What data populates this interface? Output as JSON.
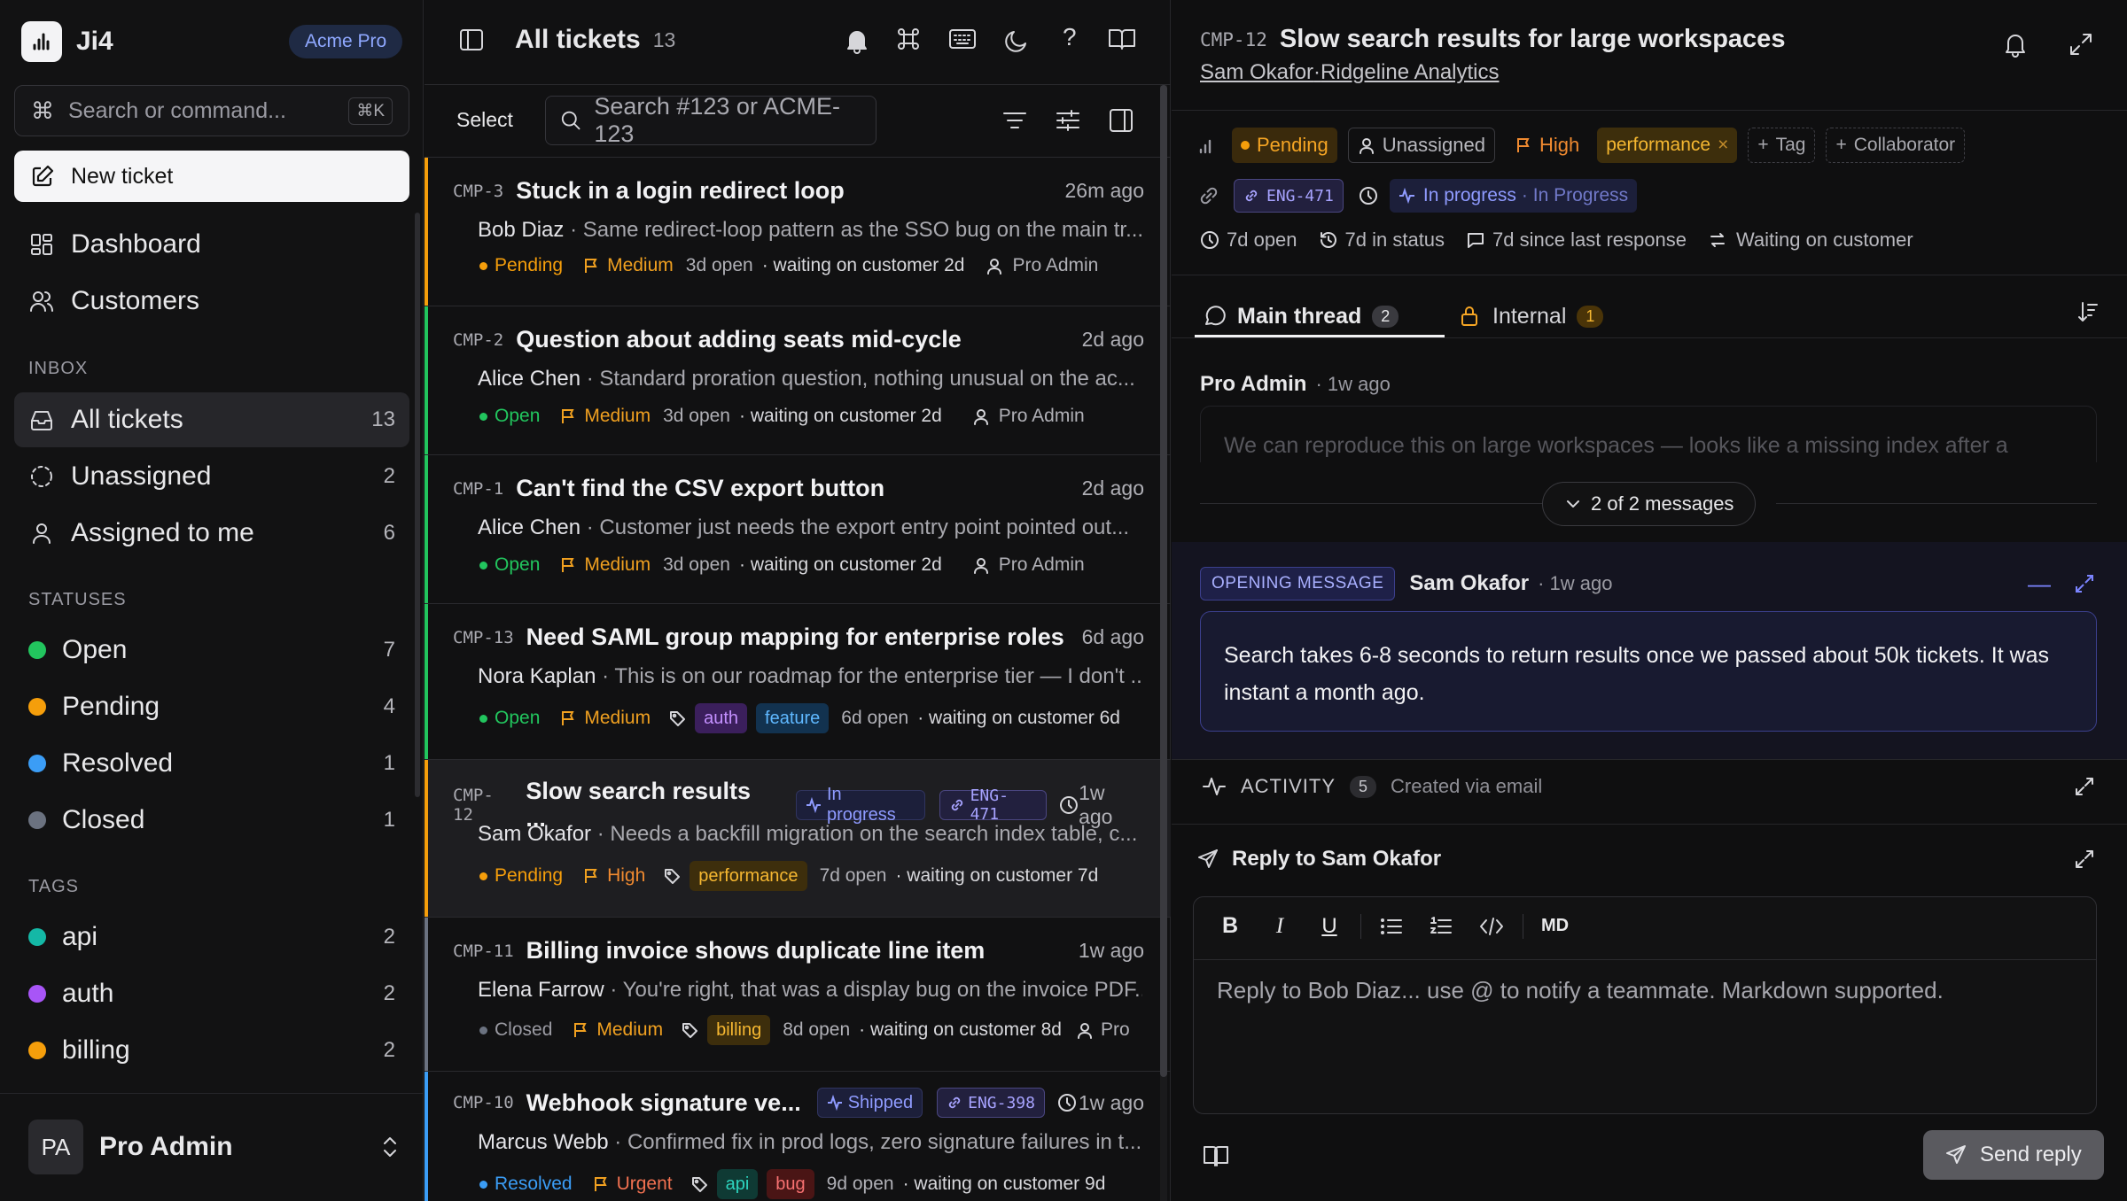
{
  "brand": {
    "name": "Ji4",
    "plan": "Acme Pro"
  },
  "sidebar": {
    "search_placeholder": "Search or command...",
    "search_shortcut": "⌘K",
    "new_ticket": "New ticket",
    "nav": [
      {
        "label": "Dashboard"
      },
      {
        "label": "Customers"
      }
    ],
    "inbox_title": "INBOX",
    "inbox": [
      {
        "label": "All tickets",
        "count": "13"
      },
      {
        "label": "Unassigned",
        "count": "2"
      },
      {
        "label": "Assigned to me",
        "count": "6"
      }
    ],
    "statuses_title": "STATUSES",
    "statuses": [
      {
        "label": "Open",
        "count": "7",
        "color": "#22c55e"
      },
      {
        "label": "Pending",
        "count": "4",
        "color": "#f59e0b"
      },
      {
        "label": "Resolved",
        "count": "1",
        "color": "#3b82f6"
      },
      {
        "label": "Closed",
        "count": "1",
        "color": "#6b7280"
      }
    ],
    "tags_title": "TAGS",
    "tags": [
      {
        "label": "api",
        "count": "2",
        "color": "#14b8a6"
      },
      {
        "label": "auth",
        "count": "2",
        "color": "#a855f7"
      },
      {
        "label": "billing",
        "count": "2",
        "color": "#f59e0b"
      }
    ],
    "user": {
      "initials": "PA",
      "name": "Pro Admin"
    }
  },
  "list": {
    "title": "All tickets",
    "count": "13",
    "select_label": "Select",
    "search_placeholder": "Search #123 or ACME-123",
    "tickets": [
      {
        "id": "CMP-3",
        "title": "Stuck in a login redirect loop",
        "age": "26m ago",
        "customer": "Bob Diaz",
        "preview": "· Same redirect-loop pattern as the SSO bug on the main tr...",
        "status": "Pending",
        "priority": "Medium",
        "open": "3d open",
        "waiting": "· waiting on customer 2d",
        "assignee": "Pro Admin"
      },
      {
        "id": "CMP-2",
        "title": "Question about adding seats mid-cycle",
        "age": "2d ago",
        "customer": "Alice Chen",
        "preview": "· Standard proration question, nothing unusual on the ac...",
        "status": "Open",
        "priority": "Medium",
        "open": "3d open",
        "waiting": "· waiting on customer 2d",
        "assignee": "Pro Admin"
      },
      {
        "id": "CMP-1",
        "title": "Can't find the CSV export button",
        "age": "2d ago",
        "customer": "Alice Chen",
        "preview": "· Customer just needs the export entry point pointed out...",
        "status": "Open",
        "priority": "Medium",
        "open": "3d open",
        "waiting": "· waiting on customer 2d",
        "assignee": "Pro Admin"
      },
      {
        "id": "CMP-13",
        "title": "Need SAML group mapping for enterprise roles",
        "age": "6d ago",
        "customer": "Nora Kaplan",
        "preview": "· This is on our roadmap for the enterprise tier — I don't ...",
        "status": "Open",
        "priority": "Medium",
        "tags": [
          "auth",
          "feature"
        ],
        "open": "6d open",
        "waiting": "· waiting on customer 6d"
      },
      {
        "id": "CMP-12",
        "title": "Slow search results ...",
        "age": "1w ago",
        "customer": "Sam Okafor",
        "preview": "· Needs a backfill migration on the search index table, c...",
        "status": "Pending",
        "priority": "High",
        "tags": [
          "performance"
        ],
        "open": "7d open",
        "waiting": "· waiting on customer 7d",
        "badge": "In progress",
        "link": "ENG-471"
      },
      {
        "id": "CMP-11",
        "title": "Billing invoice shows duplicate line item",
        "age": "1w ago",
        "customer": "Elena Farrow",
        "preview": "· You're right, that was a display bug on the invoice PDF...",
        "status": "Closed",
        "priority": "Medium",
        "tags": [
          "billing"
        ],
        "open": "8d open",
        "waiting": "· waiting on customer 8d",
        "assignee": "Pro"
      },
      {
        "id": "CMP-10",
        "title": "Webhook signature ve...",
        "age": "1w ago",
        "customer": "Marcus Webb",
        "preview": "· Confirmed fix in prod logs, zero signature failures in t...",
        "status": "Resolved",
        "priority": "Urgent",
        "tags": [
          "api",
          "bug"
        ],
        "open": "9d open",
        "waiting": "· waiting on customer 9d",
        "badge": "Shipped",
        "link": "ENG-398"
      }
    ]
  },
  "detail": {
    "id": "CMP-12",
    "title": "Slow search results for large workspaces",
    "customer": "Sam Okafor",
    "company": "Ridgeline Analytics",
    "status": "Pending",
    "assignee": "Unassigned",
    "priority": "High",
    "tag": "performance",
    "add_tag": "Tag",
    "collaborator": "Collaborator",
    "link": "ENG-471",
    "progress": "In progress",
    "progress_sub": "· In Progress",
    "stats": [
      "7d open",
      "7d in status",
      "7d since last response",
      "Waiting on customer"
    ],
    "tabs": [
      {
        "label": "Main thread",
        "count": "2"
      },
      {
        "label": "Internal",
        "count": "1"
      }
    ],
    "thread": {
      "author": "Pro Admin",
      "time": "· 1w ago",
      "preview": "We can reproduce this on large workspaces — looks like a missing index after a",
      "collapse": "2 of 2 messages"
    },
    "opening": {
      "badge": "OPENING MESSAGE",
      "author": "Sam Okafor",
      "time": "· 1w ago",
      "body": "Search takes 6-8 seconds to return results once we passed about 50k tickets. It was instant a month ago."
    },
    "activity": {
      "label": "ACTIVITY",
      "count": "5",
      "note": "Created via email"
    },
    "reply": {
      "title": "Reply to Sam Okafor",
      "md": "MD",
      "placeholder": "Reply to Bob Diaz... use @ to notify a teammate. Markdown supported.",
      "send": "Send reply"
    }
  }
}
